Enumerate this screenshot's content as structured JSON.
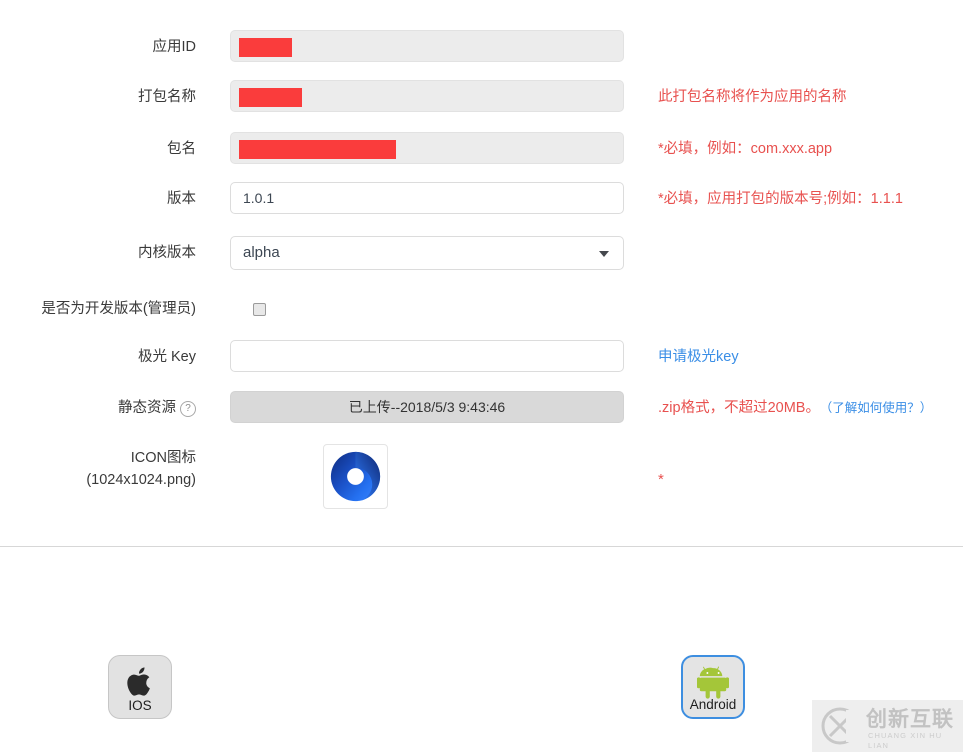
{
  "form": {
    "rows": [
      {
        "label": "应用ID",
        "control": "redacted-input",
        "value": "",
        "placeholder": "",
        "redacted_width": 53,
        "disabled": true,
        "hint": "",
        "hint_style": ""
      },
      {
        "label": "打包名称",
        "control": "redacted-input",
        "value": "",
        "placeholder": "",
        "redacted_width": 63,
        "disabled": true,
        "hint": "此打包名称将作为应用的名称",
        "hint_style": "red"
      },
      {
        "label": "包名",
        "control": "redacted-input",
        "value": "",
        "placeholder": "",
        "redacted_width": 157,
        "disabled": true,
        "hint": "*必填，例如：com.xxx.app",
        "hint_style": "red"
      },
      {
        "label": "版本",
        "control": "text-input",
        "value": "1.0.1",
        "placeholder": "",
        "disabled": false,
        "hint": "*必填，应用打包的版本号;例如：1.1.1",
        "hint_style": "red"
      },
      {
        "label": "内核版本",
        "control": "select",
        "value": "alpha",
        "hint": "",
        "hint_style": ""
      },
      {
        "label": "是否为开发版本(管理员)",
        "control": "checkbox",
        "checked": false,
        "hint": "",
        "hint_style": ""
      },
      {
        "label": "极光 Key",
        "control": "text-input",
        "value": "",
        "placeholder": "",
        "disabled": false,
        "hint": "申请极光key",
        "hint_style": "blue"
      },
      {
        "label": "静态资源",
        "has_help_icon": true,
        "help_icon_glyph": "?",
        "control": "upload-button",
        "value": "已上传--2018/5/3 9:43:46",
        "hint": ".zip格式，不超过20MB。",
        "hint_sub": "（了解如何使用？）",
        "hint_style": "red"
      },
      {
        "label_line1": "ICON图标",
        "label_line2": "(1024x1024.png)",
        "control": "icon-upload",
        "icon_name": "app-logo-icon",
        "hint": "*",
        "hint_style": "asterisk"
      }
    ]
  },
  "platforms": [
    {
      "name": "ios",
      "label": "IOS",
      "icon": "apple-icon",
      "selected": false
    },
    {
      "name": "android",
      "label": "Android",
      "icon": "android-icon",
      "selected": true
    }
  ],
  "watermark": {
    "title": "创新互联",
    "subtitle": "CHUANG XIN HU LIAN",
    "logo_letter": "X"
  },
  "colors": {
    "redaction": "#fa3c3c",
    "hint_red": "#e8514f",
    "hint_blue": "#3a8ee6",
    "selected_border": "#3d8ee0",
    "android_green": "#a4c639",
    "icon_blue": "#1a6ff0"
  }
}
